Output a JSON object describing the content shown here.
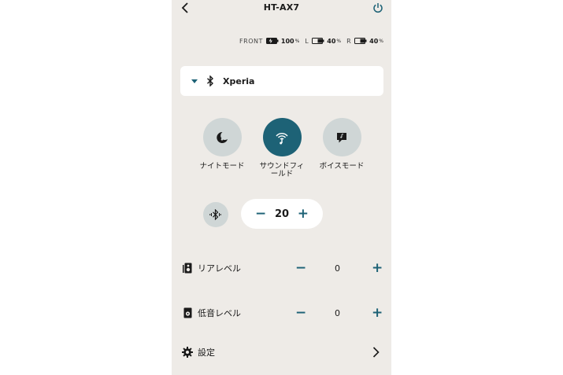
{
  "header": {
    "title": "HT-AX7",
    "back_icon": "chevron-left-icon",
    "power_icon": "power-icon",
    "accent_color": "#1d6276"
  },
  "battery": {
    "front": {
      "label": "FRONT",
      "value": "100",
      "unit": "%"
    },
    "left": {
      "label": "L",
      "value": "40",
      "unit": "%"
    },
    "right": {
      "label": "R",
      "value": "40",
      "unit": "%"
    }
  },
  "device": {
    "name": "Xperia",
    "icon": "bluetooth-icon"
  },
  "modes": [
    {
      "label": "ナイトモード",
      "icon": "night-mode-icon",
      "active": false
    },
    {
      "label": "サウンドフィ\nールド",
      "icon": "sound-field-icon",
      "active": true
    },
    {
      "label": "ボイスモード",
      "icon": "voice-mode-icon",
      "active": false
    }
  ],
  "volume": {
    "value": "20",
    "minus": "−",
    "plus": "+"
  },
  "rear_level": {
    "label": "リアレベル",
    "value": "0",
    "minus": "−",
    "plus": "+",
    "icon": "rear-speaker-icon"
  },
  "bass_level": {
    "label": "低音レベル",
    "value": "0",
    "minus": "−",
    "plus": "+",
    "icon": "subwoofer-icon"
  },
  "settings": {
    "label": "設定",
    "icon": "gear-icon"
  }
}
